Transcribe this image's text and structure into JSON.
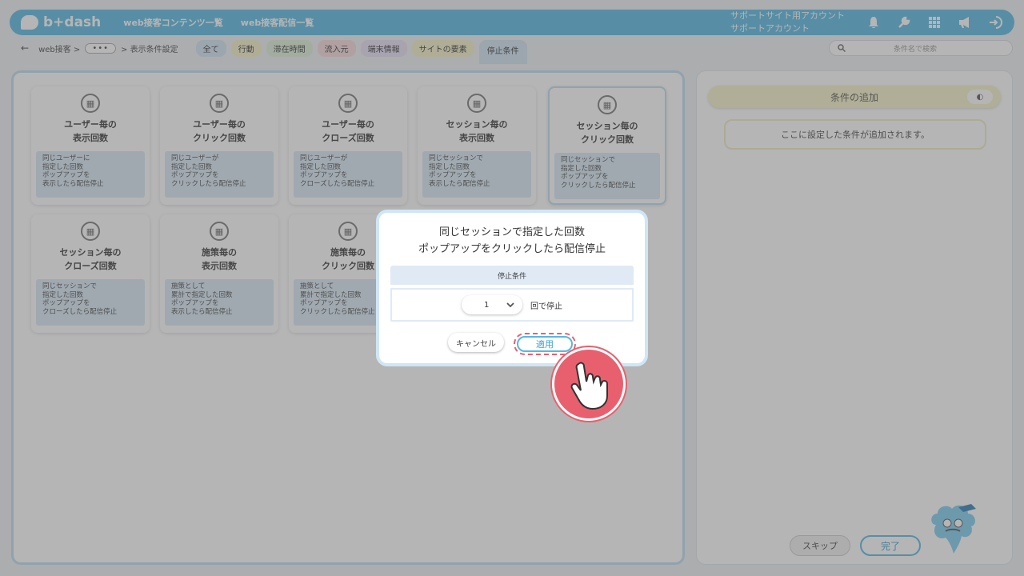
{
  "header": {
    "logo_text": "b+dash",
    "nav": [
      "web接客コンテンツ一覧",
      "web接客配信一覧"
    ],
    "account_line1": "サポートサイト用アカウント",
    "account_line2": "サポートアカウント",
    "icons": [
      "bell-icon",
      "wrench-icon",
      "grid-icon",
      "megaphone-icon",
      "logout-icon"
    ]
  },
  "subbar": {
    "back": "←",
    "crumb1": "web接客 >",
    "more": "•••",
    "crumb2": "> 表示条件設定",
    "chips": [
      {
        "label": "全て",
        "color": "#cfe3f3"
      },
      {
        "label": "行動",
        "color": "#f6f0c6"
      },
      {
        "label": "滞在時間",
        "color": "#dff0d8"
      },
      {
        "label": "流入元",
        "color": "#f8d9dc"
      },
      {
        "label": "端末情報",
        "color": "#e6def5"
      },
      {
        "label": "サイトの要素",
        "color": "#f6f0c6"
      },
      {
        "label": "停止条件",
        "color": "#cfe3f3"
      }
    ],
    "search_placeholder": "条件名で検索"
  },
  "cards": [
    {
      "title": "ユーザー毎の\n表示回数",
      "desc": "同じユーザーに\n指定した回数\nポップアップを\n表示したら配信停止"
    },
    {
      "title": "ユーザー毎の\nクリック回数",
      "desc": "同じユーザーが\n指定した回数\nポップアップを\nクリックしたら配信停止"
    },
    {
      "title": "ユーザー毎の\nクローズ回数",
      "desc": "同じユーザーが\n指定した回数\nポップアップを\nクローズしたら配信停止"
    },
    {
      "title": "セッション毎の\n表示回数",
      "desc": "同じセッションで\n指定した回数\nポップアップを\n表示したら配信停止"
    },
    {
      "title": "セッション毎の\nクリック回数",
      "desc": "同じセッションで\n指定した回数\nポップアップを\nクリックしたら配信停止"
    },
    {
      "title": "セッション毎の\nクローズ回数",
      "desc": "同じセッションで\n指定した回数\nポップアップを\nクローズしたら配信停止"
    },
    {
      "title": "施策毎の\n表示回数",
      "desc": "施策として\n累計で指定した回数\nポップアップを\n表示したら配信停止"
    },
    {
      "title": "施策毎の\nクリック回数",
      "desc": "施策として\n累計で指定した回数\nポップアップを\nクリックしたら配信停止"
    }
  ],
  "right": {
    "add_title": "条件の追加",
    "placeholder": "ここに設定した条件が追加されます。",
    "skip": "スキップ",
    "done": "完了"
  },
  "modal": {
    "title": "同じセッションで指定した回数\nポップアップをクリックしたら配信停止",
    "section": "停止条件",
    "value": "1",
    "suffix": "回で停止",
    "cancel": "キャンセル",
    "apply": "適用"
  }
}
